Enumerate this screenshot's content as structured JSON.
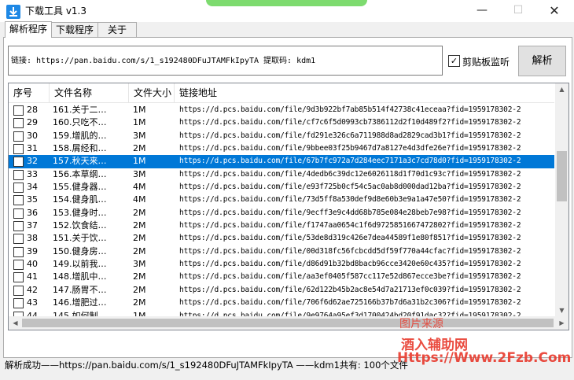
{
  "window": {
    "title": "下载工具  v1.3",
    "min_icon": "minimize-icon",
    "max_icon": "maximize-icon",
    "close_icon": "close-icon"
  },
  "tabs": [
    "解析程序",
    "下载程序",
    "关于"
  ],
  "link_input": {
    "value": "链接: https://pan.baidu.com/s/1_s192480DFuJTAMFkIpyTA 提取码: kdm1"
  },
  "clipboard_monitor": {
    "label": "剪贴板监听",
    "checked": true
  },
  "parse_button": {
    "label": "解析"
  },
  "columns": [
    "序号",
    "文件名称",
    "文件大小",
    "链接地址"
  ],
  "rows": [
    {
      "no": "28",
      "name": "161.关于二…",
      "size": "1M",
      "url": "https://d.pcs.baidu.com/file/9d3b922bf7ab85b514f42738c41eceaa?fid=1959178302-2"
    },
    {
      "no": "29",
      "name": "160.只吃不…",
      "size": "1M",
      "url": "https://d.pcs.baidu.com/file/cf7c6f5d0993cb7386112d2f10d489f2?fid=1959178302-2"
    },
    {
      "no": "30",
      "name": "159.增肌的…",
      "size": "3M",
      "url": "https://d.pcs.baidu.com/file/fd291e326c6a711988d8ad2829cad3b1?fid=1959178302-2"
    },
    {
      "no": "31",
      "name": "158.屑经和…",
      "size": "2M",
      "url": "https://d.pcs.baidu.com/file/9bbee03f25b9467d7a8127e4d3dfe26e?fid=1959178302-2"
    },
    {
      "no": "32",
      "name": "157.秋天来…",
      "size": "1M",
      "url": "https://d.pcs.baidu.com/file/67b7fc972a7d284eec7171a3c7cd78d0?fid=1959178302-2",
      "selected": true
    },
    {
      "no": "33",
      "name": "156.本草纲…",
      "size": "3M",
      "url": "https://d.pcs.baidu.com/file/4dedb6c39dc12e6026118d1f70d1c93c?fid=1959178302-2"
    },
    {
      "no": "34",
      "name": "155.健身器…",
      "size": "4M",
      "url": "https://d.pcs.baidu.com/file/e93f725b0cf54c5ac0ab8d000dad12ba?fid=1959178302-2"
    },
    {
      "no": "35",
      "name": "154.健身肌…",
      "size": "4M",
      "url": "https://d.pcs.baidu.com/file/73d5ff8a530def9d8e60b3e9a1a47e50?fid=1959178302-2"
    },
    {
      "no": "36",
      "name": "153.健身时…",
      "size": "2M",
      "url": "https://d.pcs.baidu.com/file/9ecff3e9c4dd68b785e084e28beb7e98?fid=1959178302-2"
    },
    {
      "no": "37",
      "name": "152.饮食结…",
      "size": "2M",
      "url": "https://d.pcs.baidu.com/file/f1747aa0654c1f6d9725851667472802?fid=1959178302-2"
    },
    {
      "no": "38",
      "name": "151.关于饮…",
      "size": "2M",
      "url": "https://d.pcs.baidu.com/file/53de8d319c426e7dea44589f1e80f851?fid=1959178302-2"
    },
    {
      "no": "39",
      "name": "150.健身房…",
      "size": "2M",
      "url": "https://d.pcs.baidu.com/file/00d318fc56fcbcdd5df59f770a44cfac?fid=1959178302-2"
    },
    {
      "no": "40",
      "name": "149.以前我…",
      "size": "3M",
      "url": "https://d.pcs.baidu.com/file/d86d91b32bd8bacb96cce3420e60c435?fid=1959178302-2"
    },
    {
      "no": "41",
      "name": "148.增肌中…",
      "size": "2M",
      "url": "https://d.pcs.baidu.com/file/aa3ef0405f587cc117e52d867ecce3be?fid=1959178302-2"
    },
    {
      "no": "42",
      "name": "147.肠胃不…",
      "size": "2M",
      "url": "https://d.pcs.baidu.com/file/62d122b45b2ac8e54d7a21713ef0c039?fid=1959178302-2"
    },
    {
      "no": "43",
      "name": "146.增肥过…",
      "size": "2M",
      "url": "https://d.pcs.baidu.com/file/706f6d62ae725166b37b7d6a31b2c306?fid=1959178302-2"
    },
    {
      "no": "44",
      "name": "145.如何制…",
      "size": "1M",
      "url": "https://d.pcs.baidu.com/file/9e9764a95ef3d1700424bd20f91dac32?fid=1959178302-2"
    },
    {
      "no": "45",
      "name": "144.增肌增…",
      "size": "2M",
      "url": "https://d.pcs.baidu.com/file/3b92dcd1ec8ccb5c10…81?fid=1959178302-2"
    }
  ],
  "status_text": "解析成功——https://pan.baidu.com/s/1_s192480DFuJTAMFkIpyTA  ——kdm1共有: 100个文件",
  "watermark": {
    "line1": "图片来源",
    "line2": "酒入辅助网",
    "line3": "Https://Www.2Fzb.Com"
  }
}
